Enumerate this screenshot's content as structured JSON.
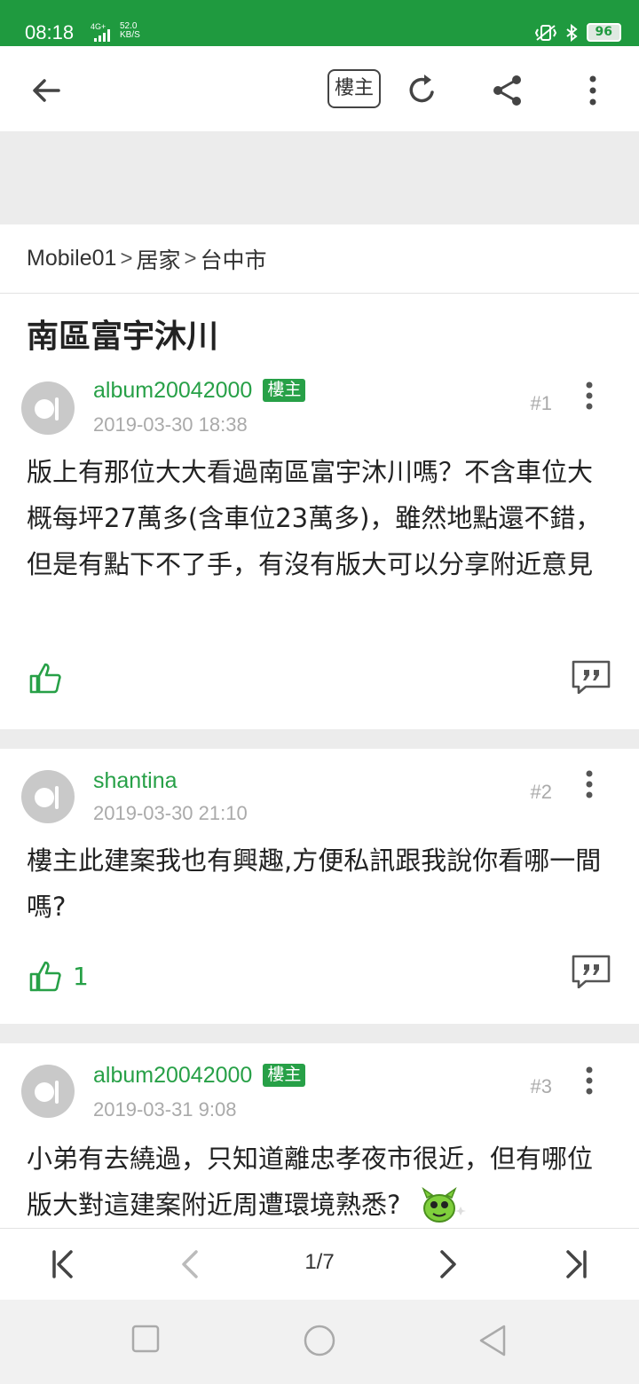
{
  "status_bar": {
    "time": "08:18",
    "network_type": "4G+",
    "speed_value": "52.0",
    "speed_unit": "KB/S",
    "battery": "96"
  },
  "toolbar": {
    "owner_filter_label": "樓主"
  },
  "breadcrumb": [
    "Mobile01",
    "居家",
    "台中市"
  ],
  "thread_title": "南區富宇沐川",
  "posts": [
    {
      "author": "album20042000",
      "is_owner": true,
      "owner_label": "樓主",
      "time": "2019-03-30 18:38",
      "floor": "#1",
      "content": "版上有那位大大看過南區富宇沐川嗎？不含車位大概每坪27萬多(含車位23萬多)，雖然地點還不錯，但是有點下不了手，有沒有版大可以分享附近意見",
      "likes": ""
    },
    {
      "author": "shantina",
      "is_owner": false,
      "owner_label": "",
      "time": "2019-03-30 21:10",
      "floor": "#2",
      "content": "樓主此建案我也有興趣,方便私訊跟我說你看哪一間嗎?",
      "likes": "1"
    },
    {
      "author": "album20042000",
      "is_owner": true,
      "owner_label": "樓主",
      "time": "2019-03-31 9:08",
      "floor": "#3",
      "content": "小弟有去繞過，只知道離忠孝夜市很近，但有哪位版大對這建案附近周遭環境熟悉?",
      "likes": ""
    }
  ],
  "pager": {
    "page_indicator": "1/7"
  },
  "colors": {
    "brand_green": "#1f9a3f",
    "author_green": "#27a047",
    "divider_gray": "#ececec"
  },
  "icons": [
    "back-arrow-icon",
    "refresh-icon",
    "share-icon",
    "more-vert-icon",
    "thumbs-up-icon",
    "quote-icon",
    "first-page-icon",
    "prev-page-icon",
    "next-page-icon",
    "last-page-icon",
    "nav-recents-icon",
    "nav-home-icon",
    "nav-back-icon"
  ]
}
